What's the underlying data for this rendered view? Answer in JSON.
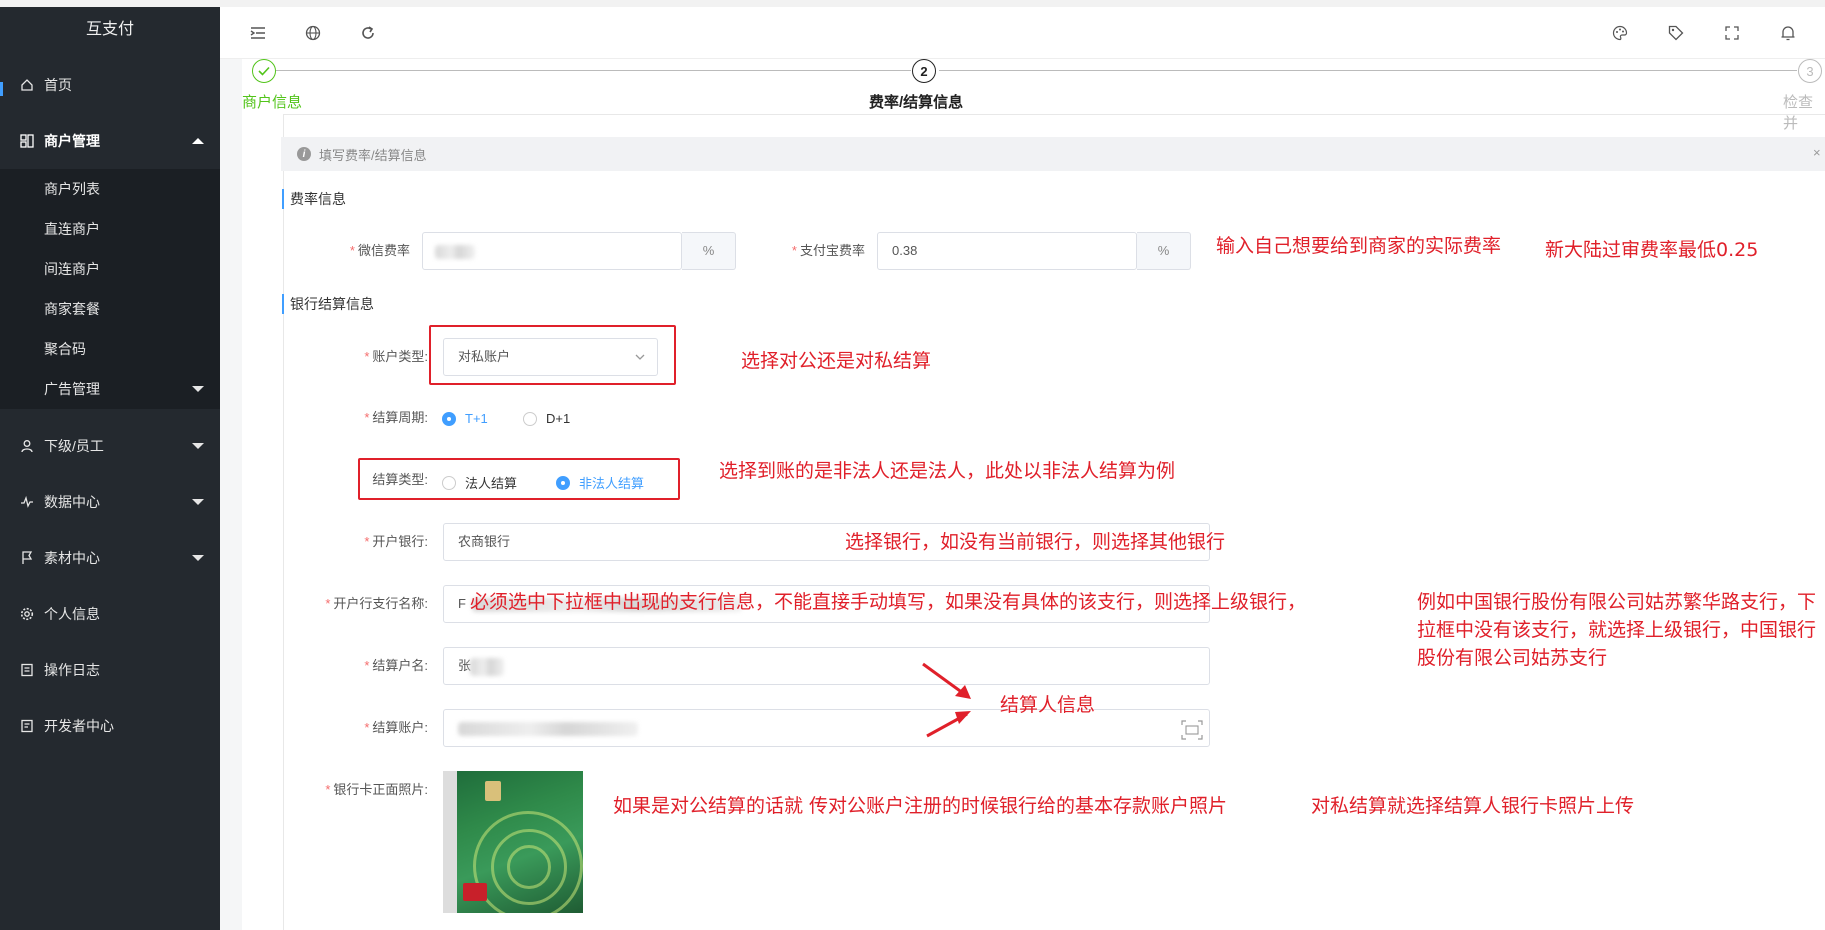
{
  "app": {
    "title": "互支付"
  },
  "sidebar": {
    "items": [
      {
        "label": "首页",
        "icon": "home-icon"
      },
      {
        "label": "商户管理",
        "icon": "merchant-icon"
      },
      {
        "label": "下级/员工",
        "icon": "user-icon"
      },
      {
        "label": "数据中心",
        "icon": "chart-icon"
      },
      {
        "label": "素材中心",
        "icon": "flag-icon"
      },
      {
        "label": "个人信息",
        "icon": "gear-icon"
      },
      {
        "label": "操作日志",
        "icon": "log-icon"
      },
      {
        "label": "开发者中心",
        "icon": "doc-icon"
      }
    ],
    "subitems": [
      "商户列表",
      "直连商户",
      "间连商户",
      "商家套餐",
      "聚合码",
      "广告管理"
    ]
  },
  "header": {
    "icons": [
      "menu-fold-icon",
      "globe-icon",
      "refresh-icon",
      "palette-icon",
      "tag-icon",
      "fullscreen-icon",
      "bell-icon"
    ]
  },
  "steps": [
    {
      "num": "✓",
      "label": "商户信息",
      "state": "done"
    },
    {
      "num": "2",
      "label": "费率/结算信息",
      "state": "active"
    },
    {
      "num": "3",
      "label": "检查并",
      "state": "pending"
    }
  ],
  "alert": {
    "text": "填写费率/结算信息",
    "close": "×"
  },
  "rate_section": {
    "title": "费率信息",
    "wechat_label": "微信费率",
    "wechat_suffix": "%",
    "alipay_label": "支付宝费率",
    "alipay_value": "0.38",
    "alipay_suffix": "%"
  },
  "bank_section": {
    "title": "银行结算信息",
    "account_type_label": "账户类型:",
    "account_type_value": "对私账户",
    "cycle_label": "结算周期:",
    "cycle_options": [
      "T+1",
      "D+1"
    ],
    "cycle_selected": "T+1",
    "settle_type_label": "结算类型:",
    "settle_type_options": [
      "法人结算",
      "非法人结算"
    ],
    "settle_type_selected": "非法人结算",
    "bank_label": "开户银行:",
    "bank_value": "农商银行",
    "branch_label": "开户行支行名称:",
    "branch_value_prefix": "F",
    "name_label": "结算户名:",
    "name_value_prefix": "张",
    "account_label": "结算账户:",
    "photo_label": "银行卡正面照片:"
  },
  "annotations": {
    "rate": "输入自己想要给到商家的实际费率",
    "rate_min": "新大陆过审费率最低0.25",
    "account_type": "选择对公还是对私结算",
    "settle_type": "选择到账的是非法人还是法人，此处以非法人结算为例",
    "bank": "选择银行，如没有当前银行，则选择其他银行",
    "branch": "必须选中下拉框中出现的支行信息，不能直接手动填写，如果没有具体的该支行，则选择上级银行，",
    "branch_example": "例如中国银行股份有限公司姑苏繁华路支行，下拉框中没有该支行，就选择上级银行，中国银行股份有限公司姑苏支行",
    "settler": "结算人信息",
    "photo_public": "如果是对公结算的话就 传对公账户注册的时候银行给的基本存款账户照片",
    "photo_private": "对私结算就选择结算人银行卡照片上传"
  },
  "colors": {
    "sidebar_bg": "#24292f",
    "accent": "#409eff",
    "annotation_red": "#e0202a",
    "step_done": "#52c41a"
  }
}
